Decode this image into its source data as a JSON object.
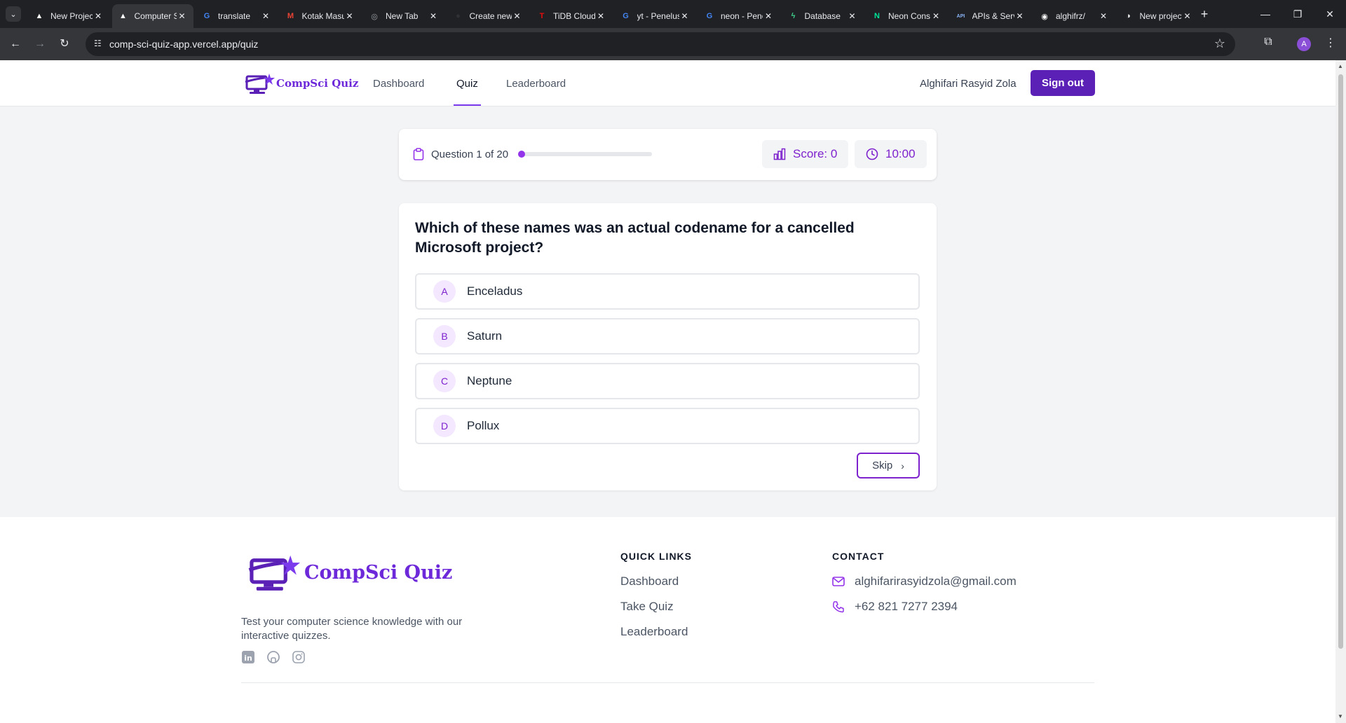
{
  "browser": {
    "tabs": [
      {
        "title": "New Project",
        "favicon": "vercel-icon",
        "color": "#ffffff"
      },
      {
        "title": "Computer Science Quiz",
        "favicon": "vercel-icon",
        "color": "#ffffff",
        "active": true
      },
      {
        "title": "translate",
        "favicon": "google-icon",
        "color": "#4285f4"
      },
      {
        "title": "Kotak Masuk",
        "favicon": "gmail-icon",
        "color": "#ea4335"
      },
      {
        "title": "New Tab",
        "favicon": "chrome-icon",
        "color": "#9aa0a6"
      },
      {
        "title": "Create new",
        "favicon": "dark-icon",
        "color": "#303134"
      },
      {
        "title": "TiDB Cloud",
        "favicon": "tidb-icon",
        "color": "#e60c0c"
      },
      {
        "title": "yt - Penelusuran",
        "favicon": "google-icon",
        "color": "#4285f4"
      },
      {
        "title": "neon - Penelusuran",
        "favicon": "google-icon",
        "color": "#4285f4"
      },
      {
        "title": "Database",
        "favicon": "bolt-icon",
        "color": "#3ecf8e"
      },
      {
        "title": "Neon Console",
        "favicon": "neon-icon",
        "color": "#00e599"
      },
      {
        "title": "APIs & Services",
        "favicon": "api-icon",
        "color": "#8ab4f8"
      },
      {
        "title": "alghifrz/",
        "favicon": "github-icon",
        "color": "#ffffff"
      },
      {
        "title": "New project",
        "favicon": "circle-icon",
        "color": "#ffffff"
      }
    ],
    "url": "comp-sci-quiz-app.vercel.app/quiz",
    "profile_initial": "A"
  },
  "header": {
    "brand": "CompSci Quiz",
    "nav": [
      {
        "label": "Dashboard"
      },
      {
        "label": "Quiz",
        "active": true
      },
      {
        "label": "Leaderboard"
      }
    ],
    "user_name": "Alghifari Rasyid Zola",
    "sign_out_label": "Sign out"
  },
  "status": {
    "question_label": "Question 1 of 20",
    "current_question": 1,
    "total_questions": 20,
    "score_label": "Score: 0",
    "timer": "10:00"
  },
  "question": {
    "text": "Which of these names was an actual codename for a cancelled Microsoft project?",
    "options": [
      {
        "letter": "A",
        "text": "Enceladus"
      },
      {
        "letter": "B",
        "text": "Saturn"
      },
      {
        "letter": "C",
        "text": "Neptune"
      },
      {
        "letter": "D",
        "text": "Pollux"
      }
    ],
    "skip_label": "Skip"
  },
  "footer": {
    "brand": "CompSci Quiz",
    "tagline": "Test your computer science knowledge with our interactive quizzes.",
    "quick_links_heading": "QUICK LINKS",
    "quick_links": [
      "Dashboard",
      "Take Quiz",
      "Leaderboard"
    ],
    "contact_heading": "CONTACT",
    "email": "alghifarirasyidzola@gmail.com",
    "phone": "+62 821 7277 2394",
    "social": [
      "linkedin-icon",
      "github-icon",
      "instagram-icon"
    ]
  },
  "colors": {
    "brand_purple": "#6d28d9",
    "button_purple": "#5b21b6",
    "accent_purple": "#7e22ce",
    "page_bg": "#f3f4f6"
  }
}
